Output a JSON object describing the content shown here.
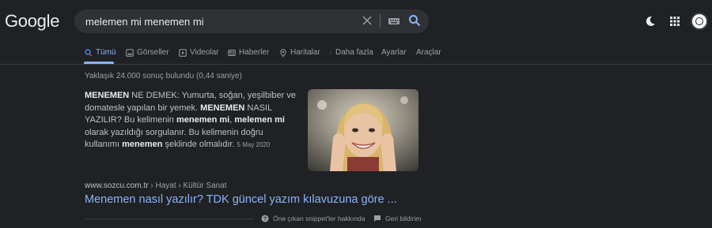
{
  "logo": {
    "text": "Google"
  },
  "search": {
    "query": "melemen mi menemen mi"
  },
  "tabs": [
    {
      "label": "Tümü",
      "icon": "search-icon",
      "active": true
    },
    {
      "label": "Görseller",
      "icon": "image-icon"
    },
    {
      "label": "Videolar",
      "icon": "video-icon"
    },
    {
      "label": "Haberler",
      "icon": "news-icon"
    },
    {
      "label": "Haritalar",
      "icon": "map-pin-icon"
    },
    {
      "label": "Daha fazla",
      "icon": "more-vert-icon"
    },
    {
      "label": "Ayarlar"
    },
    {
      "label": "Araçlar"
    }
  ],
  "stats": "Yaklaşık 24.000 sonuç bulundu (0,44 saniye)",
  "snippet": {
    "parts": [
      {
        "text": "MENEMEN",
        "bold": true
      },
      {
        "text": " NE DEMEK: Yumurta, soğan, yeşilbiber ve domatesle yapılan bir yemek. "
      },
      {
        "text": "MENEMEN",
        "bold": true
      },
      {
        "text": " NASIL YAZILIR? Bu kelimenin "
      },
      {
        "text": "menemen mi",
        "bold": true
      },
      {
        "text": ", "
      },
      {
        "text": "melemen mi",
        "bold": true
      },
      {
        "text": " olarak yazıldığı sorgulanır. Bu kelimenin doğru kullanımı "
      },
      {
        "text": "menemen",
        "bold": true
      },
      {
        "text": " şeklinde olmalıdır."
      }
    ],
    "date": "5 May 2020"
  },
  "result": {
    "domain": "www.sozcu.com.tr",
    "breadcrumb": "› Hayat › Kültür Sanat",
    "title": "Menemen nasıl yazılır? TDK güncel yazım kılavuzuna göre ..."
  },
  "footer": {
    "about": "Öne çıkan snippet'ler hakkında",
    "feedback": "Geri bildirim"
  },
  "colors": {
    "background": "#202124",
    "link": "#8ab4f8",
    "text": "#bdc1c6",
    "muted": "#9aa0a6"
  }
}
